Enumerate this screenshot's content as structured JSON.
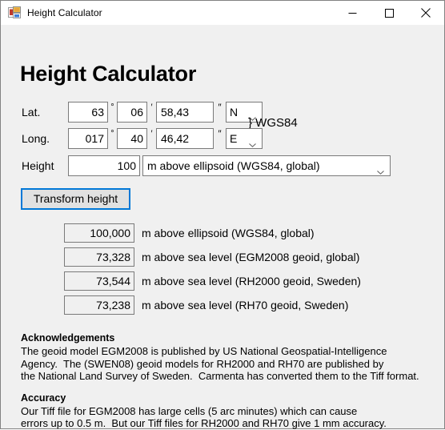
{
  "window": {
    "title": "Height Calculator",
    "icon": "app-window-icon",
    "minimize_label": "—",
    "maximize_label": "□",
    "close_label": "✕"
  },
  "page_title": "Height Calculator",
  "coordinates": {
    "datum_note": "} WGS84",
    "lat": {
      "label": "Lat.",
      "degrees": "63",
      "degrees_symbol": "°",
      "minutes": "06",
      "minutes_symbol": "′",
      "seconds": "58,43",
      "seconds_symbol": "″",
      "hemisphere": "N"
    },
    "long": {
      "label": "Long.",
      "degrees": "017",
      "degrees_symbol": "°",
      "minutes": "40",
      "minutes_symbol": "′",
      "seconds": "46,42",
      "seconds_symbol": "″",
      "hemisphere": "E"
    }
  },
  "height_input": {
    "label": "Height",
    "value": "100",
    "reference_system": "m above ellipsoid (WGS84, global)"
  },
  "transform_button": {
    "label": "Transform height"
  },
  "results": [
    {
      "value": "100,000",
      "label": "m above ellipsoid (WGS84, global)"
    },
    {
      "value": "73,328",
      "label": "m above sea level (EGM2008 geoid, global)"
    },
    {
      "value": "73,544",
      "label": "m above sea level (RH2000 geoid, Sweden)"
    },
    {
      "value": "73,238",
      "label": "m above sea level (RH70 geoid, Sweden)"
    }
  ],
  "acknowledgements": {
    "heading": "Acknowledgements",
    "line1": "The geoid model EGM2008 is published by US National Geospatial-Intelligence",
    "line2": "Agency.  The (SWEN08) geoid models for RH2000 and RH70 are published by",
    "line3": "the National Land Survey of Sweden.  Carmenta has converted them to the Tiff format."
  },
  "accuracy": {
    "heading": "Accuracy",
    "line1": "Our Tiff file for EGM2008 has large cells (5 arc minutes) which can cause",
    "line2": "errors up to 0.5 m.  But our Tiff files for RH2000 and RH70 give 1 mm accuracy."
  },
  "colors": {
    "window_background": "#f0f0f0",
    "titlebar_background": "#ffffff",
    "focus_border": "#0078d7",
    "field_border": "#7a7a7a",
    "window_border": "#828282"
  }
}
